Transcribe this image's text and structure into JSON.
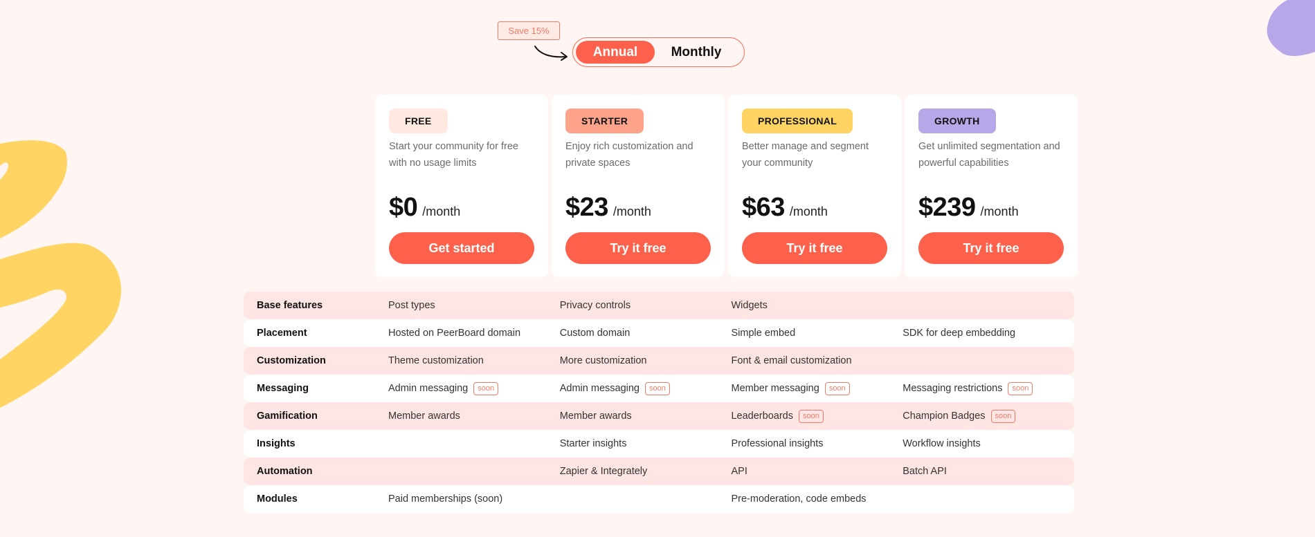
{
  "billing": {
    "save_badge": "Save 15%",
    "options": [
      {
        "label": "Annual",
        "active": true
      },
      {
        "label": "Monthly",
        "active": false
      }
    ]
  },
  "plans": [
    {
      "tier": "FREE",
      "tier_color": "#ffe9e1",
      "description": "Start your community for free with no usage limits",
      "price": "$0",
      "period": "/month",
      "cta": "Get started"
    },
    {
      "tier": "STARTER",
      "tier_color": "#fca38a",
      "description": "Enjoy rich customization and private spaces",
      "price": "$23",
      "period": "/month",
      "cta": "Try it free"
    },
    {
      "tier": "PROFESSIONAL",
      "tier_color": "#ffd463",
      "description": "Better manage and segment your community",
      "price": "$63",
      "period": "/month",
      "cta": "Try it free"
    },
    {
      "tier": "GROWTH",
      "tier_color": "#b8a7e8",
      "description": "Get unlimited segmentation and powerful capabilities",
      "price": "$239",
      "period": "/month",
      "cta": "Try it free"
    }
  ],
  "soon_label": "soon",
  "features": [
    {
      "name": "Base features",
      "values": [
        {
          "text": "Post types"
        },
        {
          "text": "Privacy controls"
        },
        {
          "text": "Widgets"
        },
        {
          "text": ""
        }
      ]
    },
    {
      "name": "Placement",
      "values": [
        {
          "text": "Hosted on PeerBoard domain"
        },
        {
          "text": "Custom domain"
        },
        {
          "text": "Simple embed"
        },
        {
          "text": "SDK for deep embedding"
        }
      ]
    },
    {
      "name": "Customization",
      "values": [
        {
          "text": "Theme customization"
        },
        {
          "text": "More customization"
        },
        {
          "text": "Font & email customization"
        },
        {
          "text": ""
        }
      ]
    },
    {
      "name": "Messaging",
      "values": [
        {
          "text": "Admin messaging",
          "soon": true
        },
        {
          "text": "Admin messaging",
          "soon": true
        },
        {
          "text": "Member messaging",
          "soon": true
        },
        {
          "text": "Messaging restrictions",
          "soon": true
        }
      ]
    },
    {
      "name": "Gamification",
      "values": [
        {
          "text": "Member awards"
        },
        {
          "text": "Member awards"
        },
        {
          "text": "Leaderboards",
          "soon": true
        },
        {
          "text": "Champion Badges",
          "soon": true
        }
      ]
    },
    {
      "name": "Insights",
      "values": [
        {
          "text": ""
        },
        {
          "text": "Starter insights"
        },
        {
          "text": "Professional insights"
        },
        {
          "text": "Workflow insights"
        }
      ]
    },
    {
      "name": "Automation",
      "values": [
        {
          "text": ""
        },
        {
          "text": "Zapier & Integrately"
        },
        {
          "text": "API"
        },
        {
          "text": "Batch API"
        }
      ]
    },
    {
      "name": "Modules",
      "values": [
        {
          "text": "Paid memberships (soon)"
        },
        {
          "text": ""
        },
        {
          "text": "Pre-moderation, code embeds"
        },
        {
          "text": ""
        }
      ]
    }
  ],
  "colors": {
    "accent": "#fd614b",
    "background": "#fff6f4",
    "row_highlight": "#ffe5e3",
    "deco_yellow": "#ffd463",
    "deco_purple": "#b8a7e8"
  }
}
